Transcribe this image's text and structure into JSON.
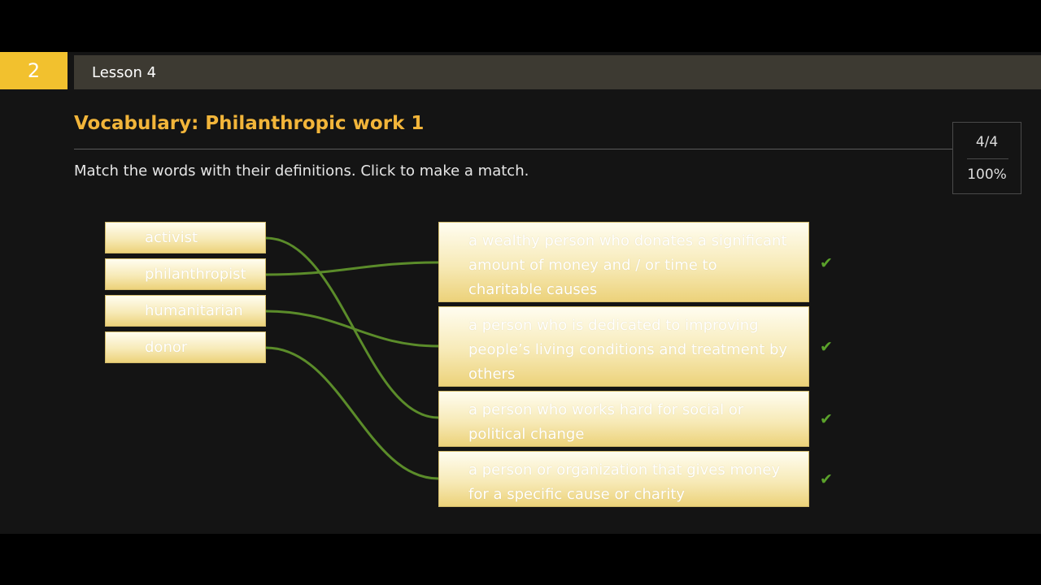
{
  "header": {
    "unit_number": "2",
    "lesson_title": "Lesson 4"
  },
  "activity": {
    "title": "Vocabulary: Philanthropic work 1",
    "instructions": "Match the words with their definitions. Click to make a match."
  },
  "score": {
    "count": "4/4",
    "percent": "100%"
  },
  "words": [
    {
      "label": "activist"
    },
    {
      "label": "philanthropist"
    },
    {
      "label": "humanitarian"
    },
    {
      "label": "donor"
    }
  ],
  "definitions": [
    {
      "text": "a wealthy person who donates a significant amount of money and / or time to charitable causes",
      "correct": true
    },
    {
      "text": "a person who is dedicated to improving people’s living conditions and treatment by others",
      "correct": true
    },
    {
      "text": "a person who works hard for social or political change",
      "correct": true
    },
    {
      "text": "a person or organization that gives money for a specific cause or charity",
      "correct": true
    }
  ],
  "matches": [
    {
      "word": 0,
      "definition": 2
    },
    {
      "word": 1,
      "definition": 0
    },
    {
      "word": 2,
      "definition": 1
    },
    {
      "word": 3,
      "definition": 3
    }
  ],
  "colors": {
    "accent": "#f2c12e",
    "title": "#f2b53a",
    "link_line": "#5b8c2a",
    "check": "#5aa12a"
  },
  "icons": {
    "check": "check-icon"
  }
}
